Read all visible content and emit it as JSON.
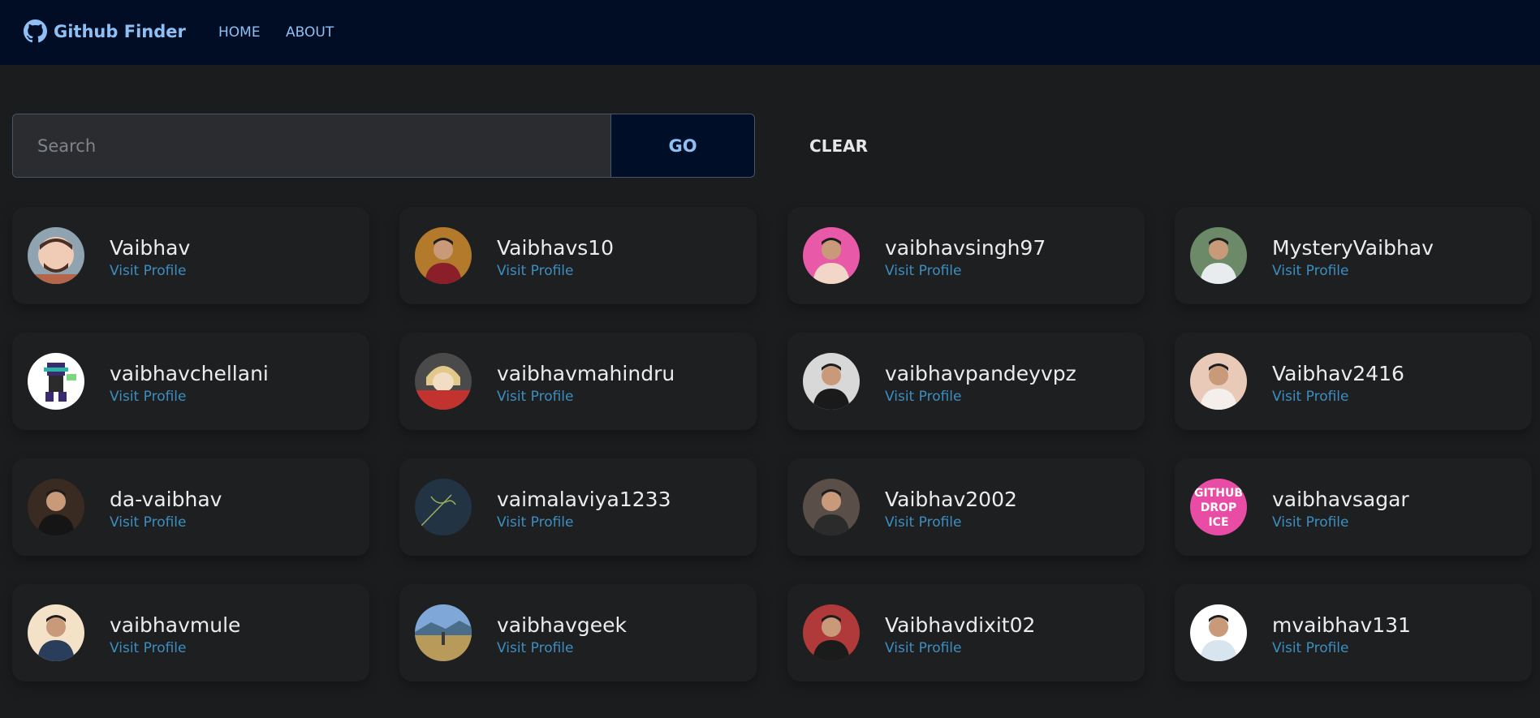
{
  "nav": {
    "brand": "Github Finder",
    "links": [
      "HOME",
      "ABOUT"
    ]
  },
  "search": {
    "placeholder": "Search",
    "value": "",
    "go_label": "GO",
    "clear_label": "CLEAR"
  },
  "users": [
    {
      "login": "Vaibhav",
      "link_label": "Visit Profile",
      "avatar": "cartoon-avatar",
      "bg": "#8fa3b1",
      "fg": "#b5654a"
    },
    {
      "login": "Vaibhavs10",
      "link_label": "Visit Profile",
      "avatar": "photo-avatar",
      "bg": "#b27a2a",
      "fg": "#8a1f2a"
    },
    {
      "login": "vaibhavsingh97",
      "link_label": "Visit Profile",
      "avatar": "photo-avatar",
      "bg": "#e85aa8",
      "fg": "#f2d6c8"
    },
    {
      "login": "MysteryVaibhav",
      "link_label": "Visit Profile",
      "avatar": "photo-avatar",
      "bg": "#6d8a68",
      "fg": "#e8ecef"
    },
    {
      "login": "vaibhavchellani",
      "link_label": "Visit Profile",
      "avatar": "pixel-avatar",
      "bg": "#ffffff",
      "fg": "#3a2b6e"
    },
    {
      "login": "vaibhavmahindru",
      "link_label": "Visit Profile",
      "avatar": "anime-avatar",
      "bg": "#4a4a4a",
      "fg": "#c2332f"
    },
    {
      "login": "vaibhavpandeyvpz",
      "link_label": "Visit Profile",
      "avatar": "photo-avatar",
      "bg": "#d8d8d8",
      "fg": "#1a1a1a"
    },
    {
      "login": "Vaibhav2416",
      "link_label": "Visit Profile",
      "avatar": "photo-avatar",
      "bg": "#e9c9b8",
      "fg": "#f4efea"
    },
    {
      "login": "da-vaibhav",
      "link_label": "Visit Profile",
      "avatar": "photo-avatar",
      "bg": "#3a2b22",
      "fg": "#151515"
    },
    {
      "login": "vaimalaviya1233",
      "link_label": "Visit Profile",
      "avatar": "sketch-avatar",
      "bg": "#223344",
      "fg": "#9cae5a"
    },
    {
      "login": "Vaibhav2002",
      "link_label": "Visit Profile",
      "avatar": "photo-avatar",
      "bg": "#5a4e48",
      "fg": "#2b2b2b"
    },
    {
      "login": "vaibhavsagar",
      "link_label": "Visit Profile",
      "avatar": "text-avatar",
      "bg": "#e84ca4",
      "fg": "#ffffff",
      "avatar_text": [
        "GITHUB",
        "DROP",
        "ICE"
      ]
    },
    {
      "login": "vaibhavmule",
      "link_label": "Visit Profile",
      "avatar": "photo-avatar",
      "bg": "#f4e2c8",
      "fg": "#2a3d5a"
    },
    {
      "login": "vaibhavgeek",
      "link_label": "Visit Profile",
      "avatar": "landscape-avatar",
      "bg": "#7fa8d8",
      "fg": "#b89a5a"
    },
    {
      "login": "Vaibhavdixit02",
      "link_label": "Visit Profile",
      "avatar": "photo-avatar",
      "bg": "#b03a3a",
      "fg": "#1b1b1b"
    },
    {
      "login": "mvaibhav131",
      "link_label": "Visit Profile",
      "avatar": "photo-avatar",
      "bg": "#ffffff",
      "fg": "#d8e4ee"
    }
  ]
}
